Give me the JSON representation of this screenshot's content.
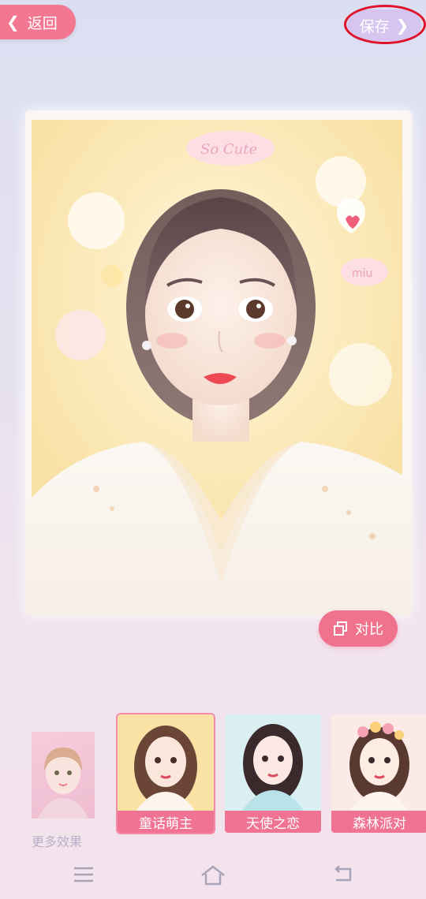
{
  "header": {
    "back_label": "返回",
    "save_label": "保存"
  },
  "photo": {
    "sticker_text_top": "So Cute",
    "sticker_text_bubble": "miu"
  },
  "compare": {
    "label": "对比"
  },
  "effects": {
    "more_label": "更多效果",
    "items": [
      {
        "label": "童话萌主",
        "selected": true
      },
      {
        "label": "天使之恋",
        "selected": false
      },
      {
        "label": "森林派对",
        "selected": false
      }
    ]
  },
  "colors": {
    "accent_pink": "#f47792",
    "save_lavender": "#d6c6ef",
    "highlight_ring": "#e0122a"
  },
  "icons": {
    "back": "chevron-left-icon",
    "save": "chevron-right-icon",
    "compare": "copy-icon",
    "nav_menu": "menu-icon",
    "nav_home": "home-icon",
    "nav_back": "back-icon"
  }
}
